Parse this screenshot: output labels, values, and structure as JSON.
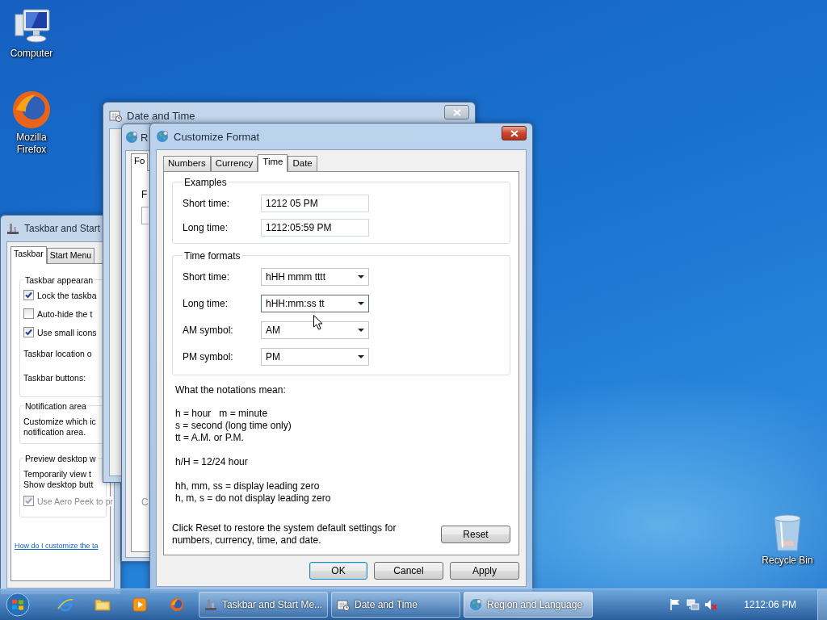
{
  "desktop": {
    "icons": [
      {
        "label": "Computer",
        "kind": "computer"
      },
      {
        "label": "Mozilla Firefox",
        "kind": "firefox"
      },
      {
        "label": "Recycle Bin",
        "kind": "recycle"
      }
    ]
  },
  "taskbar_window": {
    "title": "Taskbar and Start",
    "tabs": [
      {
        "label": "Taskbar",
        "selected": true
      },
      {
        "label": "Start Menu",
        "selected": false
      }
    ],
    "appearance": {
      "heading": "Taskbar appearan",
      "checkboxes": [
        {
          "label": "Lock the taskba",
          "checked": true,
          "disabled": false
        },
        {
          "label": "Auto-hide the t",
          "checked": false,
          "disabled": false
        },
        {
          "label": "Use small icons",
          "checked": true,
          "disabled": false
        }
      ],
      "location_label": "Taskbar location o",
      "buttons_label": "Taskbar buttons:"
    },
    "notification": {
      "heading": "Notification area",
      "text": "Customize which ic\nnotification area."
    },
    "preview": {
      "heading": "Preview desktop w",
      "text": "Temporarily view t\nShow desktop butt",
      "checkbox": {
        "label": "Use Aero Peek to pr",
        "checked": true,
        "disabled": true
      }
    },
    "help_link": "How do I customize the ta"
  },
  "date_time_window": {
    "title": "Date and Time"
  },
  "region_window": {
    "title": "R",
    "tabs": [
      {
        "label": "Fo",
        "selected": true
      }
    ],
    "text": "F",
    "link": "C"
  },
  "dialog": {
    "title": "Customize Format",
    "tabs": [
      {
        "label": "Numbers",
        "selected": false
      },
      {
        "label": "Currency",
        "selected": false
      },
      {
        "label": "Time",
        "selected": true
      },
      {
        "label": "Date",
        "selected": false
      }
    ],
    "examples": {
      "heading": "Examples",
      "rows": [
        {
          "label": "Short time:",
          "value": "1212 05 PM"
        },
        {
          "label": "Long time:",
          "value": "1212:05:59 PM"
        }
      ]
    },
    "formats": {
      "heading": "Time formats",
      "rows": [
        {
          "label": "Short time:",
          "value": "hHH mmm tttt",
          "focused": false
        },
        {
          "label": "Long time:",
          "value": "hHH:mm:ss tt",
          "focused": true
        },
        {
          "label": "AM symbol:",
          "value": "AM",
          "focused": false
        },
        {
          "label": "PM symbol:",
          "value": "PM",
          "focused": false
        }
      ]
    },
    "notes_heading": "What the notations mean:",
    "notes": [
      "h = hour   m = minute\ns = second (long time only)\ntt = A.M. or P.M.",
      "h/H = 12/24 hour",
      "hh, mm, ss = display leading zero\nh, m, s = do not display leading zero"
    ],
    "reset_text": "Click Reset to restore the system default settings for\nnumbers, currency, time, and date.",
    "reset_button": "Reset",
    "buttons": [
      {
        "label": "OK",
        "default": true
      },
      {
        "label": "Cancel",
        "default": false
      },
      {
        "label": "Apply",
        "default": false
      }
    ]
  },
  "taskbar": {
    "pinned": [
      {
        "kind": "ie"
      },
      {
        "kind": "folder"
      },
      {
        "kind": "media"
      },
      {
        "kind": "firefox"
      }
    ],
    "tasks": [
      {
        "label": "Taskbar and Start Me...",
        "kind": "taskbar",
        "selected": false
      },
      {
        "label": "Date and Time",
        "kind": "clock",
        "selected": false
      },
      {
        "label": "Region and Language",
        "kind": "globe",
        "selected": true
      }
    ],
    "tray": [
      {
        "kind": "flag"
      },
      {
        "kind": "network"
      },
      {
        "kind": "volume-muted"
      }
    ],
    "clock": "1212:06 PM"
  }
}
